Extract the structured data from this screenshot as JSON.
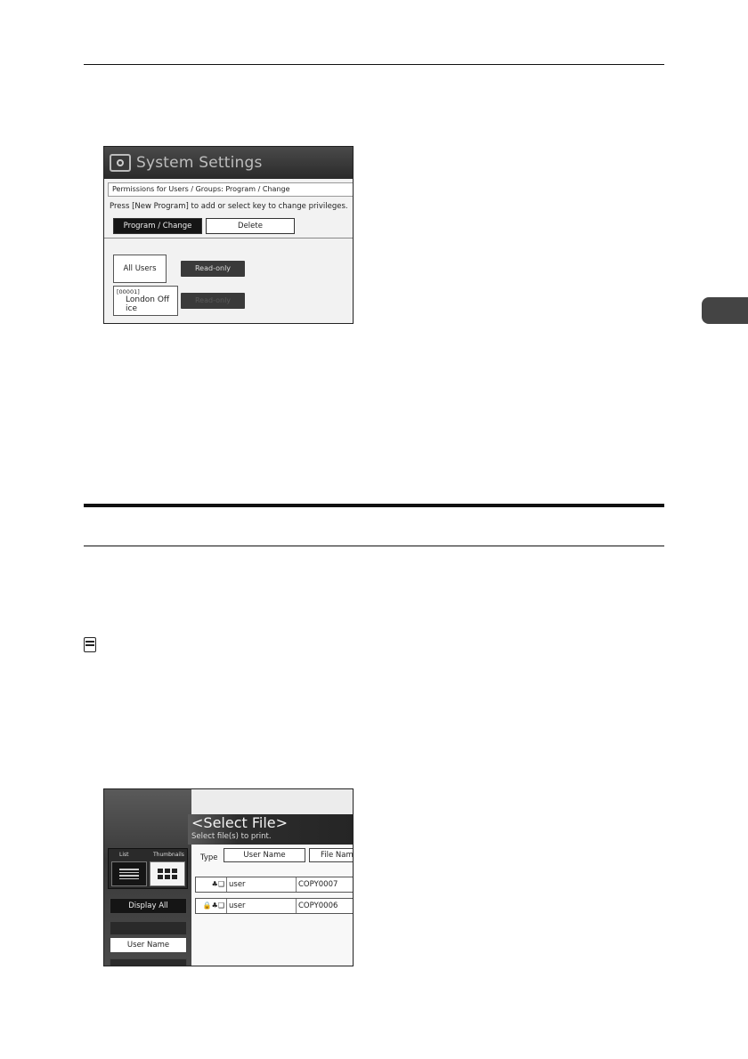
{
  "screenshot1": {
    "title": "System Settings",
    "permissions_heading": "Permissions for Users / Groups: Program / Change",
    "instruction": "Press [New Program] to add or select key to change privileges.",
    "program_change_label": "Program / Change",
    "delete_label": "Delete",
    "users": [
      {
        "code": "",
        "name": "All Users",
        "permission": "Read-only"
      },
      {
        "code": "[00001]",
        "name": "London Off ice",
        "permission": "Read-only"
      }
    ]
  },
  "screenshot2": {
    "title": "<Select File>",
    "subtitle": "Select file(s) to print.",
    "view_list_label": "List",
    "view_thumbnails_label": "Thumbnails",
    "display_all_label": "Display All",
    "user_name_button_label": "User Name",
    "columns": {
      "type": "Type",
      "user_name": "User Name",
      "file_name": "File Name"
    },
    "rows": [
      {
        "icons": "♣❑",
        "user": "user",
        "file": "COPY0007"
      },
      {
        "icons": "🔒♣❑",
        "user": "user",
        "file": "COPY0006"
      }
    ]
  },
  "colors": {
    "header_dark": "#2a2a2a",
    "chapter_tab": "#444444"
  }
}
